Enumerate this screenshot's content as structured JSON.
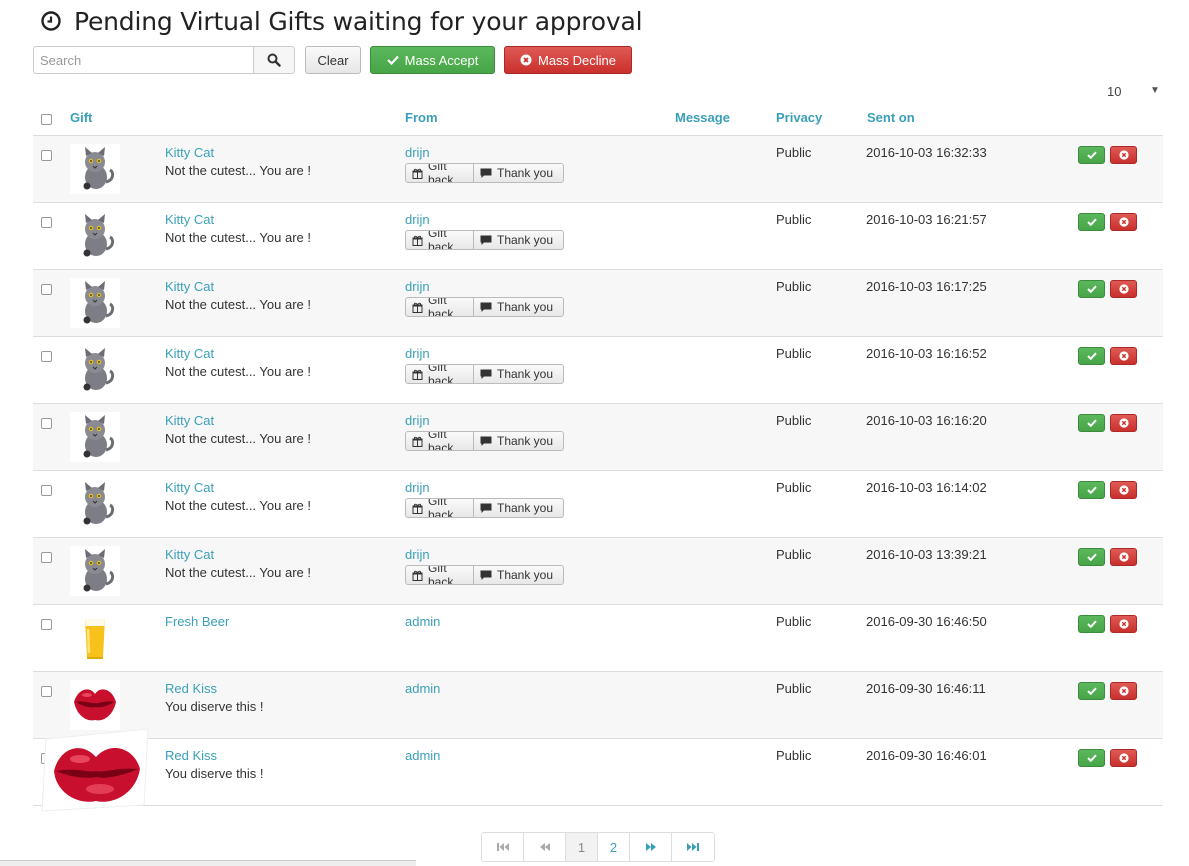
{
  "page": {
    "title": "Pending Virtual Gifts waiting for your approval"
  },
  "toolbar": {
    "search_placeholder": "Search",
    "clear_label": "Clear",
    "mass_accept_label": "Mass Accept",
    "mass_decline_label": "Mass Decline"
  },
  "per_page": {
    "selected": "10"
  },
  "table": {
    "headers": {
      "gift": "Gift",
      "from": "From",
      "message": "Message",
      "privacy": "Privacy",
      "sent_on": "Sent on"
    },
    "gift_back_label": "Gift back",
    "thank_you_label": "Thank you",
    "rows": [
      {
        "gift": "Kitty Cat",
        "note": "Not the cutest... You are !",
        "from": "drijn",
        "privacy": "Public",
        "sent": "2016-10-03 16:32:33",
        "image": "cat-icon",
        "reply_buttons": true
      },
      {
        "gift": "Kitty Cat",
        "note": "Not the cutest... You are !",
        "from": "drijn",
        "privacy": "Public",
        "sent": "2016-10-03 16:21:57",
        "image": "cat-icon",
        "reply_buttons": true
      },
      {
        "gift": "Kitty Cat",
        "note": "Not the cutest... You are !",
        "from": "drijn",
        "privacy": "Public",
        "sent": "2016-10-03 16:17:25",
        "image": "cat-icon",
        "reply_buttons": true
      },
      {
        "gift": "Kitty Cat",
        "note": "Not the cutest... You are !",
        "from": "drijn",
        "privacy": "Public",
        "sent": "2016-10-03 16:16:52",
        "image": "cat-icon",
        "reply_buttons": true
      },
      {
        "gift": "Kitty Cat",
        "note": "Not the cutest... You are !",
        "from": "drijn",
        "privacy": "Public",
        "sent": "2016-10-03 16:16:20",
        "image": "cat-icon",
        "reply_buttons": true
      },
      {
        "gift": "Kitty Cat",
        "note": "Not the cutest... You are !",
        "from": "drijn",
        "privacy": "Public",
        "sent": "2016-10-03 16:14:02",
        "image": "cat-icon",
        "reply_buttons": true
      },
      {
        "gift": "Kitty Cat",
        "note": "Not the cutest... You are !",
        "from": "drijn",
        "privacy": "Public",
        "sent": "2016-10-03 13:39:21",
        "image": "cat-icon",
        "reply_buttons": true
      },
      {
        "gift": "Fresh Beer",
        "note": "",
        "from": "admin",
        "privacy": "Public",
        "sent": "2016-09-30 16:46:50",
        "image": "beer-icon",
        "reply_buttons": false
      },
      {
        "gift": "Red Kiss",
        "note": "You diserve this !",
        "from": "admin",
        "privacy": "Public",
        "sent": "2016-09-30 16:46:11",
        "image": "lips-icon",
        "reply_buttons": false
      },
      {
        "gift": "Red Kiss",
        "note": "You diserve this !",
        "from": "admin",
        "privacy": "Public",
        "sent": "2016-09-30 16:46:01",
        "image": "lips-icon",
        "reply_buttons": false
      }
    ]
  },
  "pagination": {
    "pages": [
      "1",
      "2"
    ],
    "current": "1"
  },
  "colors": {
    "accent": "#3aa0b8",
    "accept": "#5cb85c",
    "decline": "#d9534f"
  }
}
